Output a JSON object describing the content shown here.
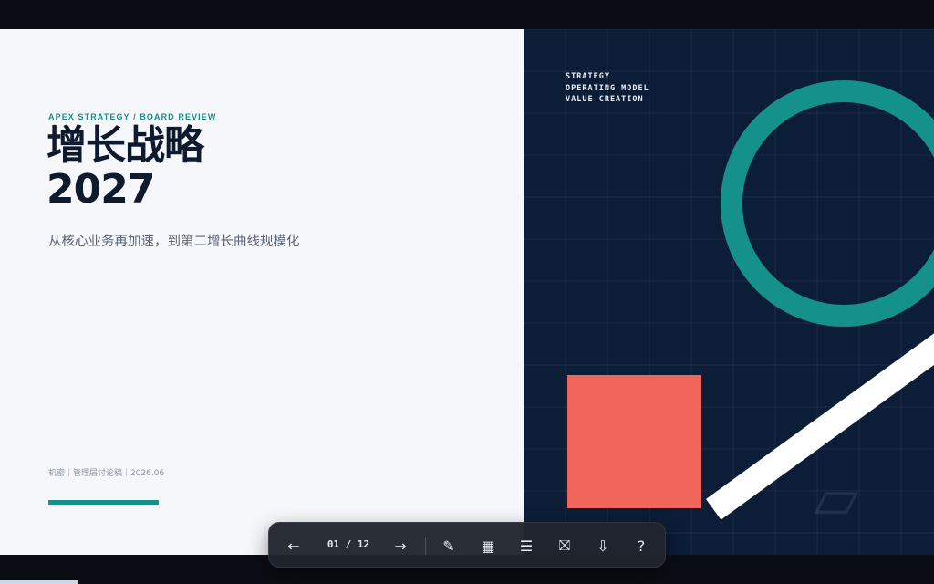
{
  "slide": {
    "kicker": "APEX STRATEGY / BOARD REVIEW",
    "title_line1": "增长战略",
    "title_line2": "2027",
    "subtitle": "从核心业务再加速，到第二增长曲线规模化",
    "meta": "机密｜管理层讨论稿｜2026.06",
    "right_labels": [
      "STRATEGY",
      "OPERATING MODEL",
      "VALUE CREATION"
    ],
    "colors": {
      "teal": "#14918a",
      "navy": "#0c1d38",
      "coral": "#ef655a",
      "ink": "#0e1b2e"
    }
  },
  "toolbar": {
    "prev_icon": "←",
    "page_counter": "01 / 12",
    "next_icon": "→",
    "pen_icon": "✎",
    "grid_icon": "▦",
    "menu_icon": "☰",
    "fullscreen_icon": "⛝",
    "download_icon": "⇩",
    "help_icon": "?"
  }
}
